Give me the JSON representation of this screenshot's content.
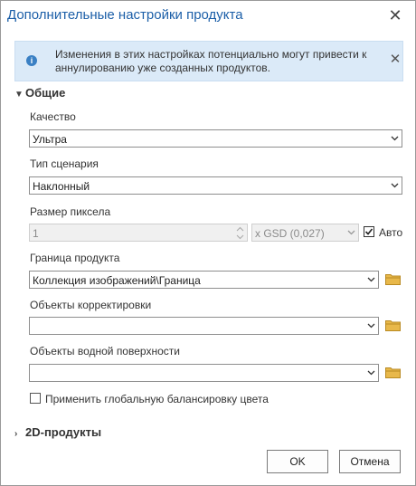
{
  "dialog": {
    "title": "Дополнительные настройки продукта"
  },
  "info": {
    "message": "Изменения в этих настройках потенциально могут привести к аннулированию уже созданных продуктов."
  },
  "general": {
    "header": "Общие",
    "quality": {
      "label": "Качество",
      "value": "Ультра"
    },
    "scenario": {
      "label": "Тип сценария",
      "value": "Наклонный"
    },
    "pixel": {
      "label": "Размер пиксела",
      "value": "1",
      "unit": "x GSD (0,027)",
      "auto_label": "Авто",
      "auto_checked": true
    },
    "boundary": {
      "label": "Граница продукта",
      "value": "Коллекция изображений\\Граница"
    },
    "correction": {
      "label": "Объекты корректировки",
      "value": ""
    },
    "water": {
      "label": "Объекты водной поверхности",
      "value": ""
    },
    "balance": {
      "label": "Применить глобальную балансировку цвета",
      "checked": false
    }
  },
  "products2d": {
    "header": "2D-продукты"
  },
  "buttons": {
    "ok": "OK",
    "cancel": "Отмена"
  }
}
